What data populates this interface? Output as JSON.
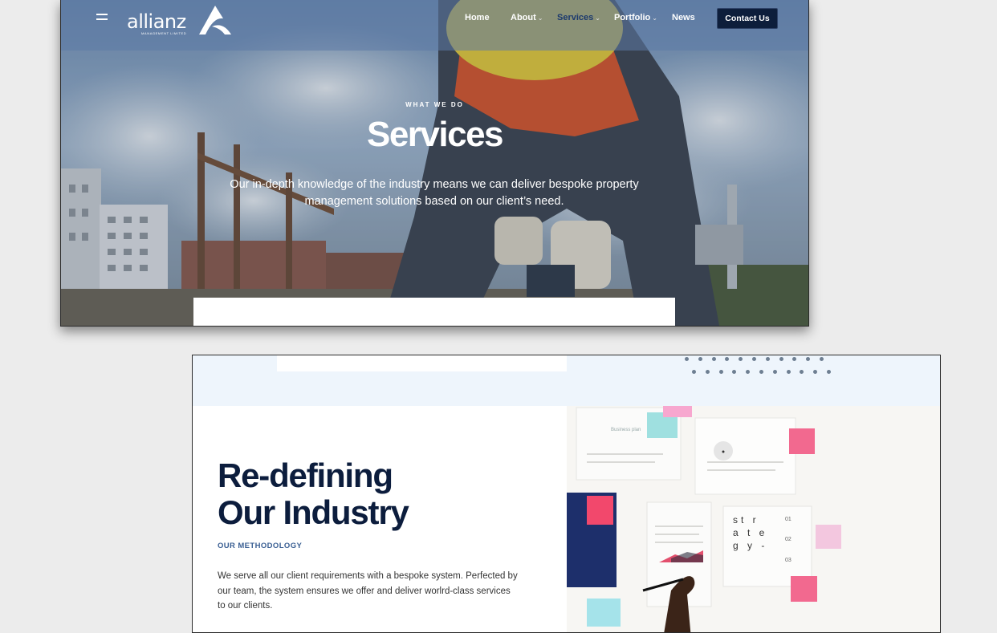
{
  "header": {
    "logo_text": "allianz",
    "logo_subtext": "MANAGEMENT LIMITED",
    "nav": [
      {
        "label": "Home",
        "has_dropdown": false,
        "active": false
      },
      {
        "label": "About",
        "has_dropdown": true,
        "active": false
      },
      {
        "label": "Services",
        "has_dropdown": true,
        "active": true
      },
      {
        "label": "Portfolio",
        "has_dropdown": true,
        "active": false
      },
      {
        "label": "News",
        "has_dropdown": false,
        "active": false
      }
    ],
    "contact_label": "Contact Us"
  },
  "hero": {
    "eyebrow": "WHAT WE DO",
    "title": "Services",
    "description": "Our in-depth knowledge of the industry means we can deliver bespoke property management solutions based on our client’s need."
  },
  "section": {
    "title_line1": "Re-defining",
    "title_line2": "Our Industry",
    "eyebrow": "OUR METHODOLOGY",
    "body": "We serve all our client requirements with a bespoke system. Perfected by our team, the system ensures we offer and deliver worlrd-class services to our clients."
  },
  "photo_note": {
    "heading": "Business plan",
    "strategy_text": "str ate gy-",
    "numbers": [
      "01",
      "02",
      "03"
    ]
  },
  "colors": {
    "navy": "#0c1d3d",
    "accent_blue": "#3a5f93",
    "band": "#eef5fc",
    "sticky_pink": "#f2698f",
    "sticky_teal": "#9fe0e0"
  },
  "icons": [
    "hamburger-icon",
    "logo-mark-icon",
    "chevron-down-icon"
  ]
}
